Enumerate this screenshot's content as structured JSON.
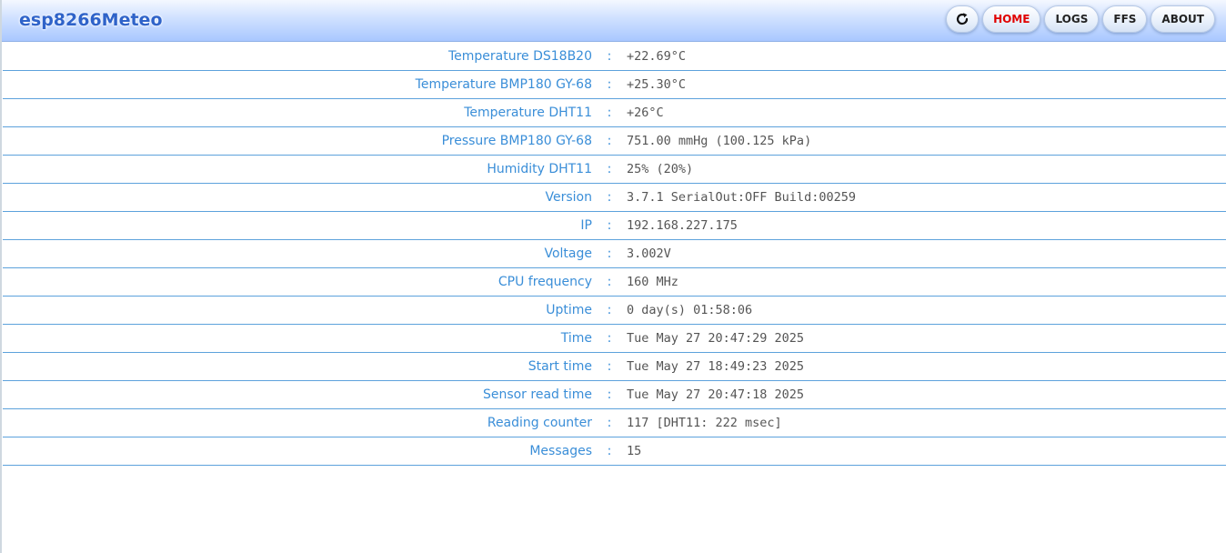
{
  "header": {
    "brand": "esp8266Meteo",
    "nav": [
      {
        "label": "",
        "icon": "refresh-icon"
      },
      {
        "label": "HOME",
        "active": true,
        "color": "#e00000"
      },
      {
        "label": "LOGS"
      },
      {
        "label": "FFS"
      },
      {
        "label": "ABOUT"
      }
    ]
  },
  "separator": ":",
  "rows": [
    {
      "label": "Temperature DS18B20",
      "value": "+22.69°C"
    },
    {
      "label": "Temperature BMP180 GY-68",
      "value": "+25.30°C"
    },
    {
      "label": "Temperature DHT11",
      "value": "+26°C"
    },
    {
      "label": "Pressure BMP180 GY-68",
      "value": "751.00 mmHg (100.125 kPa)"
    },
    {
      "label": "Humidity DHT11",
      "value": "25% (20%)"
    },
    {
      "label": "Version",
      "value": "3.7.1 SerialOut:OFF Build:00259"
    },
    {
      "label": "IP",
      "value": "192.168.227.175"
    },
    {
      "label": "Voltage",
      "value": "3.002V"
    },
    {
      "label": "CPU frequency",
      "value": "160 MHz"
    },
    {
      "label": "Uptime",
      "value": "0 day(s) 01:58:06"
    },
    {
      "label": "Time",
      "value": "Tue May 27 20:47:29 2025"
    },
    {
      "label": "Start time",
      "value": "Tue May 27 18:49:23 2025"
    },
    {
      "label": "Sensor read time",
      "value": "Tue May 27 20:47:18 2025"
    },
    {
      "label": "Reading counter",
      "value": "117 [DHT11: 222 msec]"
    },
    {
      "label": "Messages",
      "value": "15"
    }
  ],
  "colors": {
    "accent": "#3a8ed8",
    "brand": "#2f63c9",
    "active_nav": "#e00000",
    "row_border": "#5da2dc",
    "value_text": "#555555"
  }
}
